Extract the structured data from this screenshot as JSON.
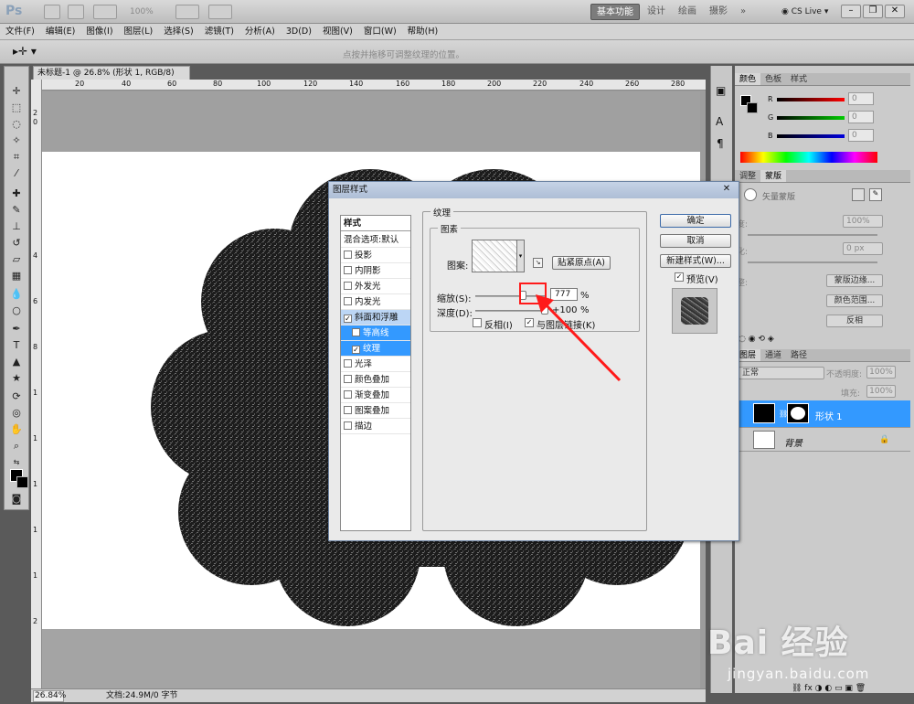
{
  "app": {
    "logo": "Ps",
    "zoom": "100%",
    "workspace": [
      "基本功能",
      "设计",
      "绘画",
      "摄影"
    ],
    "cs_live": "CS Live"
  },
  "menu": [
    "文件(F)",
    "编辑(E)",
    "图像(I)",
    "图层(L)",
    "选择(S)",
    "滤镜(T)",
    "分析(A)",
    "3D(D)",
    "视图(V)",
    "窗口(W)",
    "帮助(H)"
  ],
  "options": {
    "hint": "点按并拖移可调整纹理的位置。"
  },
  "document": {
    "tab": "未标题-1 @ 26.8% (形状 1, RGB/8) *",
    "zoom": "26.84%",
    "info": "文档:24.9M/0 字节",
    "ruler_ticks": [
      "20",
      "40",
      "60",
      "80",
      "100",
      "120",
      "140",
      "160",
      "180",
      "200",
      "220",
      "240",
      "260",
      "280"
    ],
    "vruler_ticks": [
      "2",
      "0",
      "4",
      "6",
      "8",
      "1",
      "1",
      "1",
      "1",
      "1",
      "2"
    ]
  },
  "color_panel": {
    "tabs": [
      "颜色",
      "色板",
      "样式"
    ],
    "channels": [
      {
        "label": "R",
        "value": "0"
      },
      {
        "label": "G",
        "value": "0"
      },
      {
        "label": "B",
        "value": "0"
      }
    ]
  },
  "adjust_panel": {
    "tabs": [
      "调整",
      "蒙版"
    ],
    "title": "矢量蒙版",
    "density_label": "度:",
    "density": "100%",
    "feather_label": "化:",
    "feather": "0 px",
    "edge_label": "整:",
    "buttons": [
      "蒙版边缘...",
      "颜色范围...",
      "反相"
    ]
  },
  "layers_panel": {
    "tabs": [
      "图层",
      "通道",
      "路径"
    ],
    "blend": "正常",
    "opacity_label": "不透明度:",
    "opacity": "100%",
    "fill_label": "填充:",
    "fill": "100%",
    "layers": [
      {
        "name": "形状 1",
        "selected": true
      },
      {
        "name": "背景",
        "selected": false
      }
    ]
  },
  "dialog": {
    "title": "图层样式",
    "styles_header": "样式",
    "styles": [
      {
        "label": "混合选项:默认",
        "check": false,
        "hascb": false,
        "sel": false
      },
      {
        "label": "投影",
        "check": false,
        "hascb": true,
        "sel": false
      },
      {
        "label": "内阴影",
        "check": false,
        "hascb": true,
        "sel": false
      },
      {
        "label": "外发光",
        "check": false,
        "hascb": true,
        "sel": false
      },
      {
        "label": "内发光",
        "check": false,
        "hascb": true,
        "sel": false
      },
      {
        "label": "斜面和浮雕",
        "check": true,
        "hascb": true,
        "sel": false
      },
      {
        "label": "等高线",
        "check": false,
        "hascb": true,
        "sel": false,
        "sub": true
      },
      {
        "label": "纹理",
        "check": true,
        "hascb": true,
        "sel": true,
        "sub": true
      },
      {
        "label": "光泽",
        "check": false,
        "hascb": true,
        "sel": false
      },
      {
        "label": "颜色叠加",
        "check": false,
        "hascb": true,
        "sel": false
      },
      {
        "label": "渐变叠加",
        "check": false,
        "hascb": true,
        "sel": false
      },
      {
        "label": "图案叠加",
        "check": false,
        "hascb": true,
        "sel": false
      },
      {
        "label": "描边",
        "check": false,
        "hascb": true,
        "sel": false
      }
    ],
    "texture_group": "纹理",
    "pattern_group": "图素",
    "pattern_label": "图案:",
    "snap_button": "贴紧原点(A)",
    "scale_label": "缩放(S):",
    "scale_value": "777",
    "scale_unit": "%",
    "scale_fraction": 0.68,
    "depth_label": "深度(D):",
    "depth_value": "+100",
    "depth_unit": "%",
    "depth_fraction": 1.0,
    "invert_label": "反相(I)",
    "link_label": "与图层链接(K)",
    "ok": "确定",
    "cancel": "取消",
    "new_style": "新建样式(W)...",
    "preview_label": "预览(V)"
  },
  "watermark": {
    "line1": "Bai 经验",
    "line2": "jingyan.baidu.com"
  }
}
